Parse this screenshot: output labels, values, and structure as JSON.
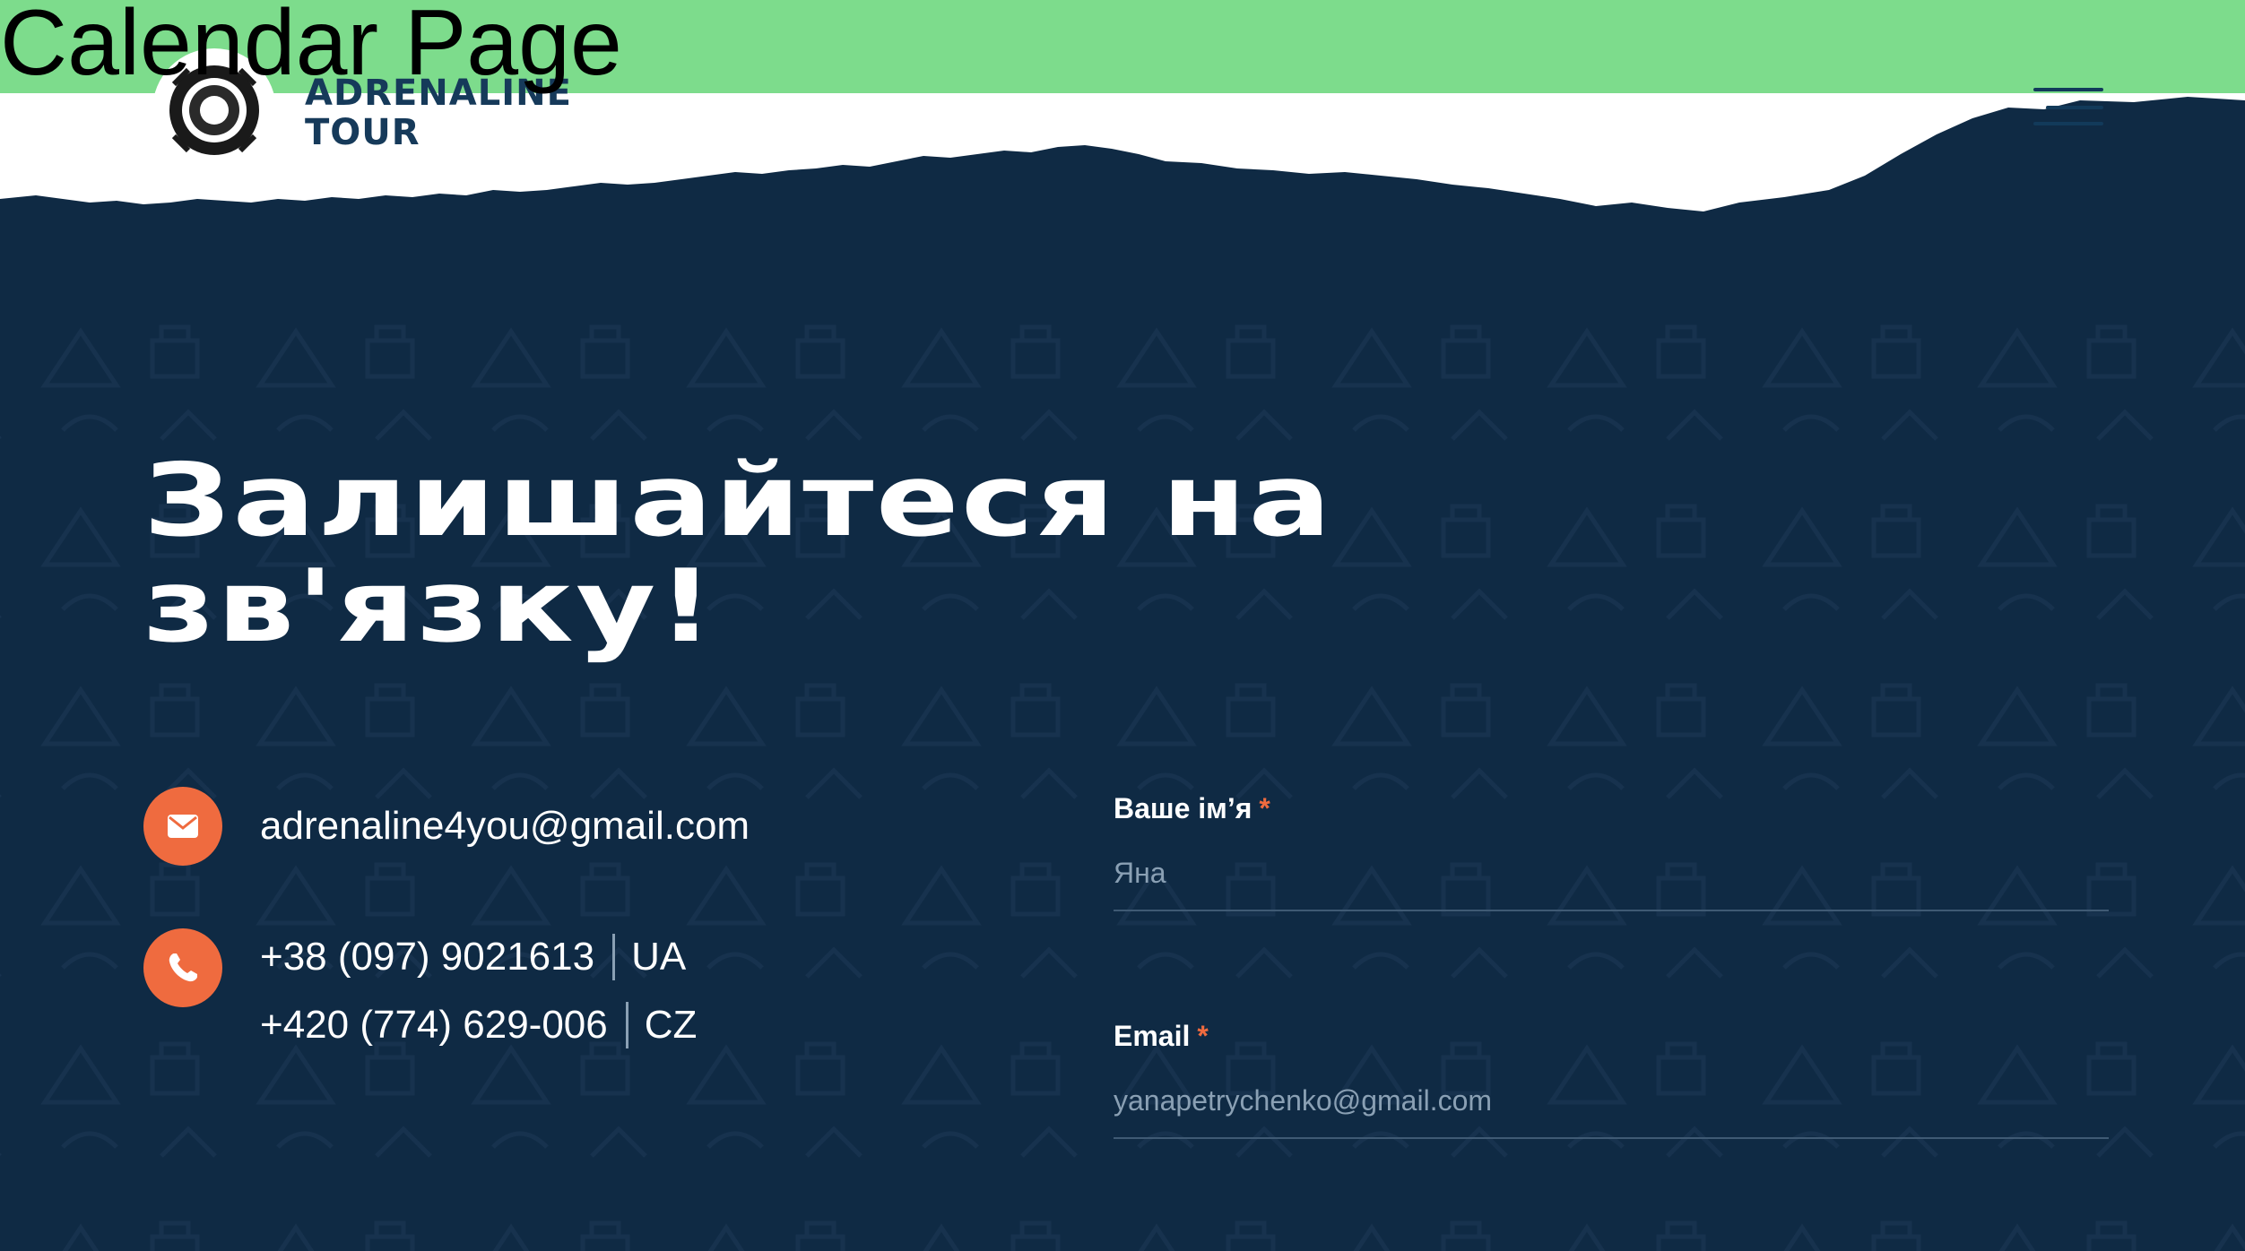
{
  "banner": {
    "title": "Calendar Page"
  },
  "brand": {
    "line1": "ADRENALINE",
    "line2": "TOUR"
  },
  "logo": {
    "icon": "adrenaline-tour-badge-logo"
  },
  "menu": {
    "icon": "hamburger-menu-icon"
  },
  "contact_section": {
    "heading_line1": "Залишайтеся на",
    "heading_line2": "зв'язку!",
    "email": "adrenaline4you@gmail.com",
    "phones": [
      {
        "number": "+38 (097) 9021613",
        "country": "UA"
      },
      {
        "number": "+420 (774) 629-006",
        "country": "CZ"
      }
    ]
  },
  "form": {
    "name_label": "Ваше ім’я",
    "name_placeholder": "Яна",
    "email_label": "Email",
    "email_placeholder": "yanapetrychenko@gmail.com",
    "required_mark": "*"
  },
  "colors": {
    "background": "#0f2a44",
    "accent": "#ef6b3f",
    "banner": "#7ddc8c"
  }
}
